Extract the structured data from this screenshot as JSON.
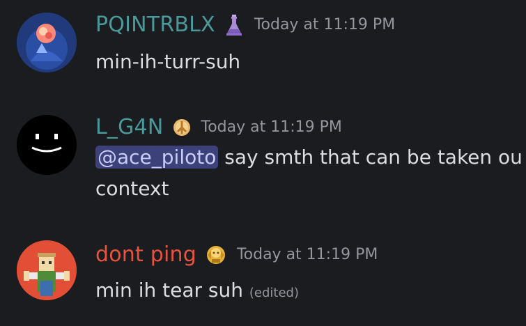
{
  "colors": {
    "background": "#1b1c1f",
    "username_teal": "#4a9a9c",
    "username_red": "#e8533e",
    "mention_bg": "#3d4179",
    "timestamp": "#94969c"
  },
  "messages": [
    {
      "username": "PQINTRBLX",
      "badge_icon": "flask-badge-icon",
      "timestamp": "Today at 11:19 PM",
      "text": "min-ih-turr-suh"
    },
    {
      "username": "L_G4N",
      "badge_icon": "peace-badge-icon",
      "timestamp": "Today at 11:19 PM",
      "mention": "@ace_piloto",
      "text_line1": " say smth that can be taken ou",
      "text_line2": "context"
    },
    {
      "username": "dont ping",
      "badge_icon": "gold-emblem-badge-icon",
      "timestamp": "Today at 11:19 PM",
      "text": "min ih tear suh",
      "edited": "(edited)"
    }
  ]
}
